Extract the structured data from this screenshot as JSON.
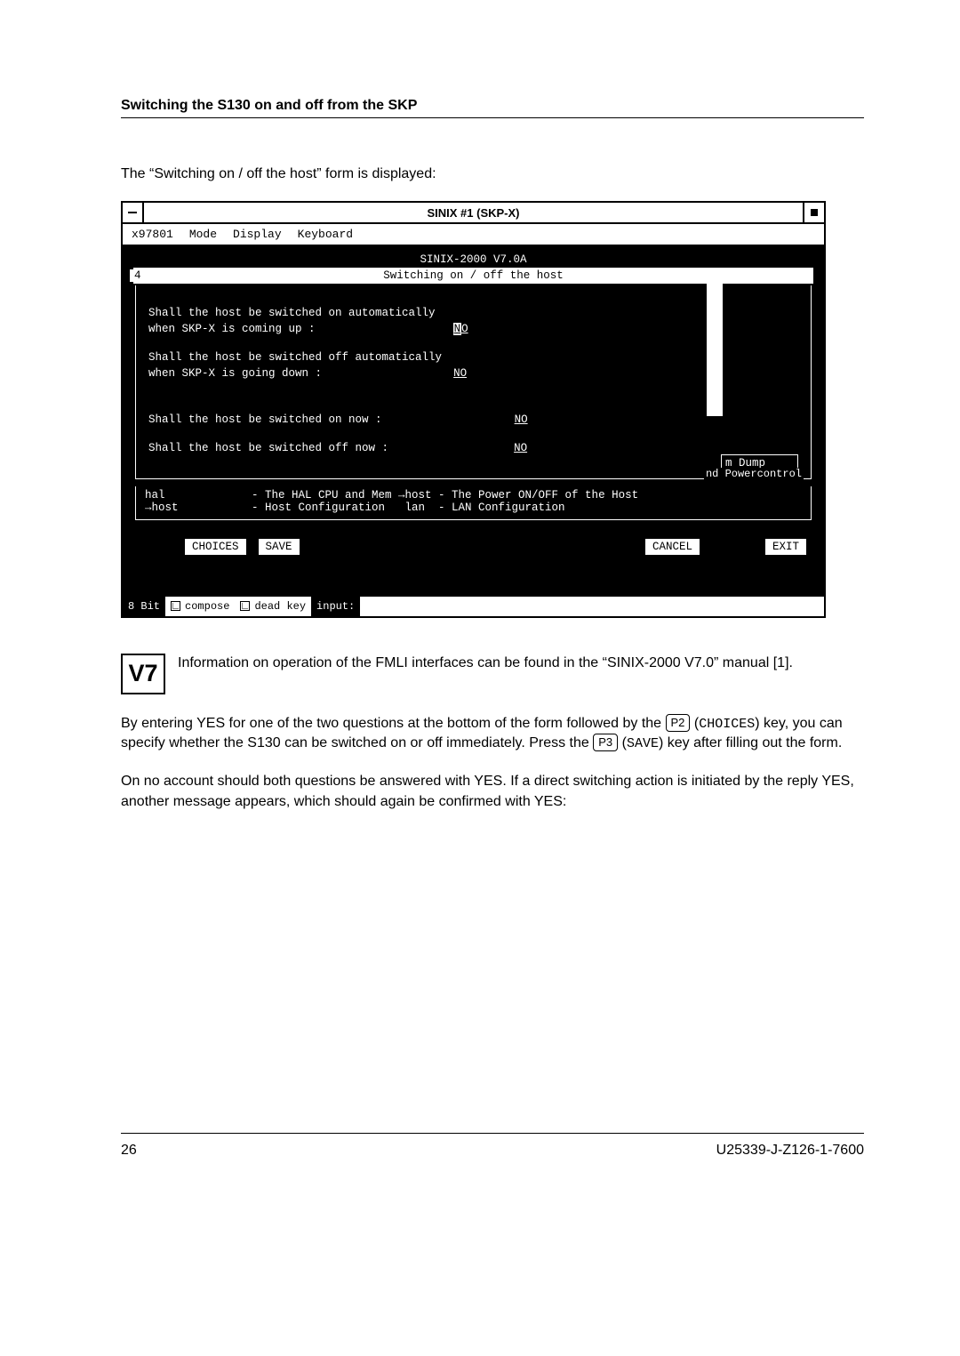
{
  "header": {
    "section_title": "Switching the S130 on and off from the SKP"
  },
  "intro": "The “Switching on / off the host” form is displayed:",
  "terminal": {
    "title": "SINIX #1 (SKP-X)",
    "menu": {
      "m1": "x97801",
      "m2": "Mode",
      "m3": "Display",
      "m4": "Keyboard"
    },
    "sinix_version": "SINIX-2000 V7.0A",
    "form_title": "Switching on / off the host",
    "num4": "4",
    "q1a": "Shall the host be switched on automatically",
    "q1b": "when SKP-X is coming up :",
    "q1v_cursor": "N",
    "q1v_rest": "O  ",
    "q2a": "Shall the host be switched off automatically",
    "q2b": "when SKP-X is going down :",
    "q2v": "NO  ",
    "q3": "Shall the host be switched on now :",
    "q3v": "NO  ",
    "q4": "Shall the host be switched off now :",
    "q4v": "NO  ",
    "mdump": "m Dump",
    "pc_label": "nd Powercontrol",
    "hal_l1": "hal",
    "hal_r1": "- The HAL CPU and Mem →host - The Power ON/OFF of the Host",
    "hal_l2": "→host",
    "hal_r2": "- Host Configuration   lan  - LAN Configuration",
    "btn_choices": "CHOICES",
    "btn_save": "SAVE",
    "btn_cancel": "CANCEL",
    "btn_exit": "EXIT",
    "status": {
      "bits": "8 Bit",
      "compose": "compose",
      "deadkey": "dead key",
      "input_label": "input:"
    }
  },
  "v7": {
    "badge": "V7",
    "text": "Information on operation of the FMLI interfaces can be found in the “SINIX-2000 V7.0” manual [1]."
  },
  "para1_a": "By entering YES for one of the two questions at the bottom of the form followed by the ",
  "key_p2": "P2",
  "mono_choices": "CHOICES",
  "para1_b": ") key, you can specify whether the S130 can be switched on or off immediately. Press the ",
  "key_p3": "P3",
  "mono_save": "SAVE",
  "para1_c": ") key after filling out the form.",
  "para2": "On no account should both questions be answered with YES. If a direct switching action is initiated by the reply YES, another message appears, which should again be confirmed with YES:",
  "footer": {
    "page": "26",
    "doc": "U25339-J-Z126-1-7600"
  }
}
